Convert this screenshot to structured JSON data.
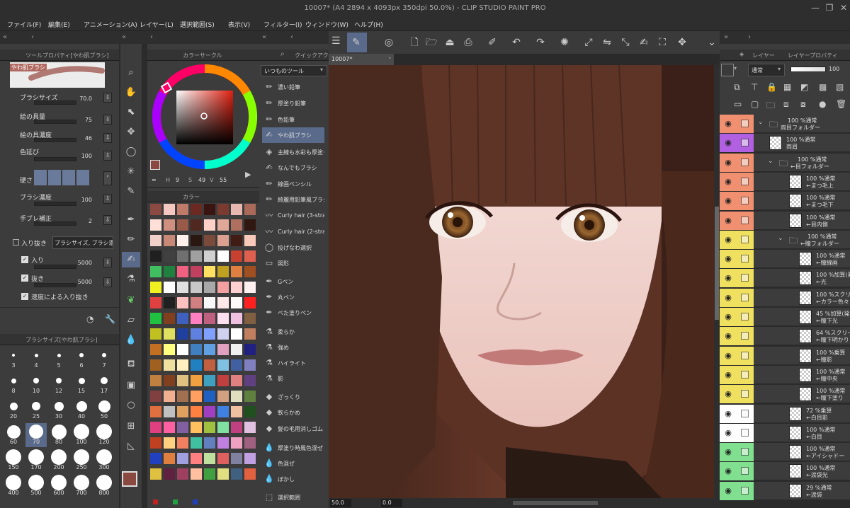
{
  "titlebar": {
    "title": "10007* (A4 2894 x 4093px 350dpi 50.0%)  - CLIP STUDIO PAINT PRO",
    "min": "—",
    "max": "❐",
    "close": "✕"
  },
  "menu": [
    "ファイル(F)",
    "編集(E)",
    "アニメーション(A)",
    "レイヤー(L)",
    "選択範囲(S)",
    "表示(V)",
    "フィルター(I)",
    "ウィンドウ(W)",
    "ヘルプ(H)"
  ],
  "tool_property": {
    "tab": "ツールプロパティ[やわ肌ブラシ]",
    "brush_name": "やわ肌ブラシ",
    "props": [
      {
        "label": "ブラシサイズ",
        "value": "70.0"
      },
      {
        "label": "絵の具量",
        "value": "75"
      },
      {
        "label": "絵の具濃度",
        "value": "46"
      },
      {
        "label": "色延び",
        "value": "100"
      }
    ],
    "hardness_label": "硬さ",
    "props2": [
      {
        "label": "ブラシ濃度",
        "value": "100"
      },
      {
        "label": "手ブレ補正",
        "value": "2"
      }
    ],
    "taper_label": "入り抜き",
    "taper_select": "ブラシサイズ, ブラシ濃",
    "taper": [
      {
        "label": "入り",
        "value": "5000"
      },
      {
        "label": "抜き",
        "value": "5000"
      }
    ],
    "speed_label": "速度による入り抜き"
  },
  "brush_size": {
    "tab": "ブラシサイズ[やわ肌ブラシ]",
    "sizes": [
      "3",
      "4",
      "5",
      "6",
      "7",
      "8",
      "10",
      "12",
      "15",
      "17",
      "20",
      "25",
      "30",
      "40",
      "50",
      "60",
      "70",
      "80",
      "100",
      "120",
      "150",
      "170",
      "200",
      "250",
      "300",
      "400",
      "500",
      "600",
      "700",
      "800"
    ],
    "selected": "70"
  },
  "color_circle": {
    "tab": "カラーサークル",
    "h_label": "H",
    "h": "9",
    "s_label": "S",
    "s": "49",
    "v_label": "V",
    "v": "55",
    "main_color": "#8a4a42",
    "sub_color": "#3a2a28"
  },
  "color_set": {
    "tab": "カラー"
  },
  "subtools": {
    "tab": "クイックアクセ",
    "group": "いつものツール",
    "items": [
      "濃い鉛筆",
      "厚塗り鉛筆",
      "色鉛筆",
      "やわ肌ブラシ",
      "主線も水彩も厚塗りも",
      "なんでもブラシ",
      "線画ペンシル",
      "綺麗用鉛筆風ブラシ",
      "Curly hair (3-strand)",
      "Curly hair (2-strand)",
      "投げなわ選択",
      "図形",
      "Gペン",
      "丸ペン",
      "ベた塗りペン",
      "柔らか",
      "強め",
      "ハイライト",
      "影",
      "ざっくり",
      "軟らかめ",
      "髪の毛用消しゴム",
      "厚塗り時風色混ぜ",
      "色混ぜ",
      "ぼかし",
      "選択範囲"
    ],
    "selected": "やわ肌ブラシ"
  },
  "canvas": {
    "tab": "10007*",
    "zoom": "50.0",
    "angle": "0.0"
  },
  "layers": {
    "tab": "レイヤー",
    "tab2": "レイヤープロパティ",
    "blend": "通常",
    "opacity": "100",
    "items": [
      {
        "l1": "100 %通常",
        "l2": "両目フォルダー",
        "indent": 0,
        "type": "folder",
        "color": "#f09070"
      },
      {
        "l1": "100 %通常",
        "l2": "両眉",
        "indent": 0,
        "type": "layer",
        "color": "#b060e0"
      },
      {
        "l1": "100 %通常",
        "l2": "←目フォルダー",
        "indent": 1,
        "type": "folder",
        "color": "#f09070"
      },
      {
        "l1": "100 %通常",
        "l2": "←まつ毛上",
        "indent": 2,
        "type": "layer",
        "color": "#f09070"
      },
      {
        "l1": "100 %通常",
        "l2": "←まつ毛下",
        "indent": 2,
        "type": "layer",
        "color": "#f09070"
      },
      {
        "l1": "100 %通常",
        "l2": "←目内側",
        "indent": 2,
        "type": "layer",
        "color": "#f09070"
      },
      {
        "l1": "100 %通常",
        "l2": "←瞳フォルダー",
        "indent": 2,
        "type": "folder",
        "color": "#f0e060"
      },
      {
        "l1": "100 %通常",
        "l2": "←瞳線画",
        "indent": 3,
        "type": "layer",
        "color": "#f0e060"
      },
      {
        "l1": "100 %加算(発",
        "l2": "←光",
        "indent": 3,
        "type": "layer",
        "color": "#f0e060",
        "clip": true
      },
      {
        "l1": "100 %スクリー",
        "l2": "←カラー色々",
        "indent": 3,
        "type": "layer",
        "color": "#f0e060",
        "clip": true
      },
      {
        "l1": "45 %加算(発",
        "l2": "←瞳下光",
        "indent": 3,
        "type": "layer",
        "color": "#f0e060",
        "clip": true
      },
      {
        "l1": "64 %スクリーン",
        "l2": "←瞳下明かり",
        "indent": 3,
        "type": "layer",
        "color": "#f0e060",
        "clip": true
      },
      {
        "l1": "100 %乗算",
        "l2": "←瞳影",
        "indent": 3,
        "type": "layer",
        "color": "#f0e060",
        "clip": true
      },
      {
        "l1": "100 %通常",
        "l2": "←瞳中央",
        "indent": 3,
        "type": "layer",
        "color": "#f0e060",
        "clip": true
      },
      {
        "l1": "100 %通常",
        "l2": "←瞳下塗り",
        "indent": 3,
        "type": "layer",
        "color": "#f0e060"
      },
      {
        "l1": "72 %乗算",
        "l2": "←白目影",
        "indent": 2,
        "type": "layer",
        "color": "#ffffff",
        "clip": true
      },
      {
        "l1": "100 %通常",
        "l2": "←白目",
        "indent": 2,
        "type": "layer",
        "color": "#ffffff"
      },
      {
        "l1": "100 %通常",
        "l2": "←アイシャドー",
        "indent": 2,
        "type": "layer",
        "color": "#80e090"
      },
      {
        "l1": "100 %通常",
        "l2": "←涙袋光",
        "indent": 2,
        "type": "layer",
        "color": "#80e090",
        "clip": true
      },
      {
        "l1": "29 %通常",
        "l2": "←涙袋",
        "indent": 2,
        "type": "layer",
        "color": "#80e090"
      }
    ]
  }
}
